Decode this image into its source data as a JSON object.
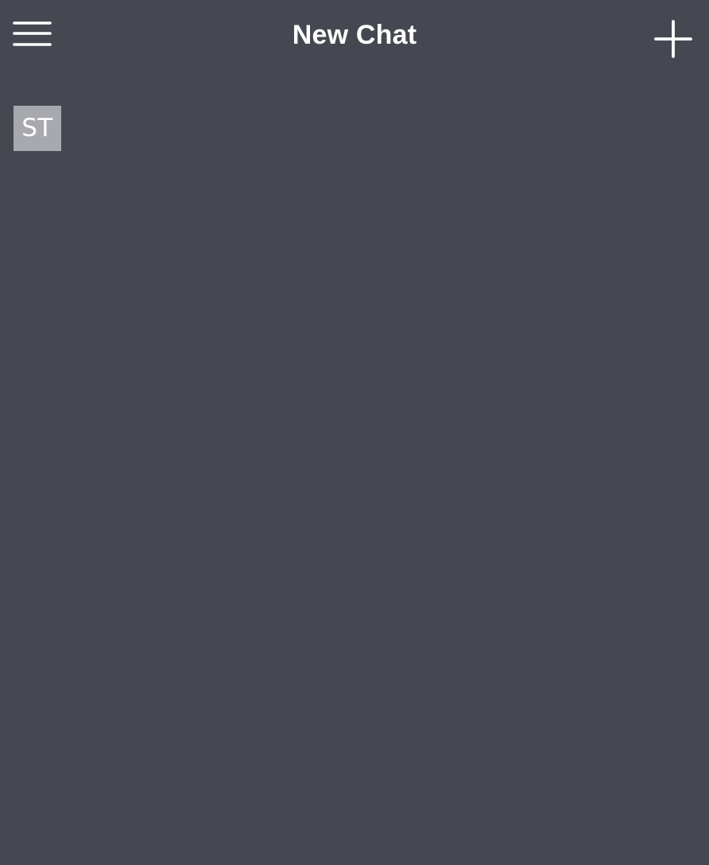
{
  "header": {
    "title": "New Chat",
    "menu_icon": "hamburger-menu-icon",
    "new_icon": "plus-icon"
  },
  "conversation": {
    "avatar_initials": "ST"
  },
  "colors": {
    "background": "#464851",
    "text": "#ffffff",
    "avatar_background": "#a7a9ae"
  }
}
